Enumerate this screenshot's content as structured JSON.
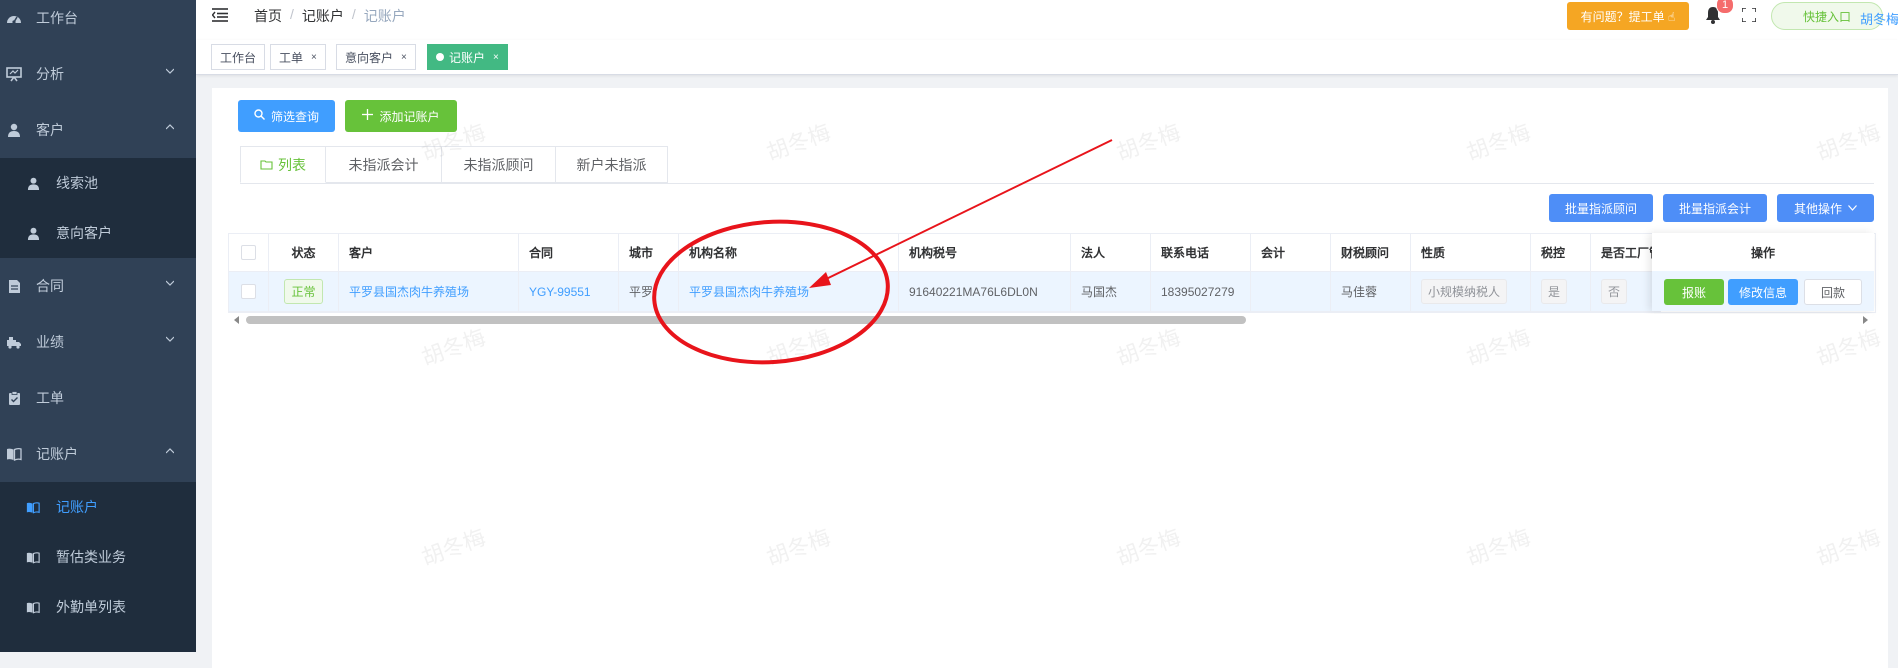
{
  "sidebar": {
    "items": [
      {
        "label": "工作台",
        "icon": "dashboard-icon"
      },
      {
        "label": "分析",
        "icon": "presentation-icon"
      },
      {
        "label": "客户",
        "icon": "user-icon"
      },
      {
        "label": "合同",
        "icon": "document-icon"
      },
      {
        "label": "业绩",
        "icon": "truck-icon"
      },
      {
        "label": "工单",
        "icon": "clipboard-icon"
      },
      {
        "label": "记账户",
        "icon": "book-icon"
      }
    ],
    "customer_sub": [
      {
        "label": "线索池"
      },
      {
        "label": "意向客户"
      }
    ],
    "account_sub": [
      {
        "label": "记账户"
      },
      {
        "label": "暂估类业务"
      },
      {
        "label": "外勤单列表"
      }
    ]
  },
  "navbar": {
    "breadcrumb": [
      "首页",
      "记账户",
      "记账户"
    ],
    "help_label": "有问题？提工单 ☝",
    "badge": "1",
    "quick_label": "快捷入口",
    "username": "胡冬梅"
  },
  "tags": [
    {
      "label": "工作台"
    },
    {
      "label": "工单"
    },
    {
      "label": "意向客户"
    },
    {
      "label": "记账户"
    }
  ],
  "toolbar": {
    "filter_label": "筛选查询",
    "add_label": "添加记账户",
    "batch_advisor_label": "批量指派顾问",
    "batch_accountant_label": "批量指派会计",
    "other_label": "其他操作"
  },
  "tabs": [
    "列表",
    "未指派会计",
    "未指派顾问",
    "新户未指派"
  ],
  "table": {
    "headers": [
      "状态",
      "客户",
      "合同",
      "城市",
      "机构名称",
      "机构税号",
      "法人",
      "联系电话",
      "会计",
      "财税顾问",
      "性质",
      "税控",
      "是否工厂管",
      "操作"
    ],
    "row": {
      "status": "正常",
      "customer": "平罗县国杰肉牛养殖场",
      "contract": "YGY-99551",
      "city": "平罗",
      "org_name": "平罗县国杰肉牛养殖场",
      "tax_no": "91640221MA76L6DL0N",
      "legal": "马国杰",
      "phone": "18395027279",
      "accountant": "",
      "advisor": "马佳蓉",
      "nature": "小规模纳税人",
      "tax_control": "是",
      "factory": "否",
      "actions": [
        "报账",
        "修改信息",
        "回款"
      ]
    }
  },
  "watermark": "胡冬梅",
  "colors": {
    "sidebar_bg": "#304156",
    "accent_blue": "#409eff",
    "accent_green": "#67c23a",
    "tag_active": "#42b983",
    "warning": "#f5a623",
    "annotation_red": "#e8141b"
  }
}
